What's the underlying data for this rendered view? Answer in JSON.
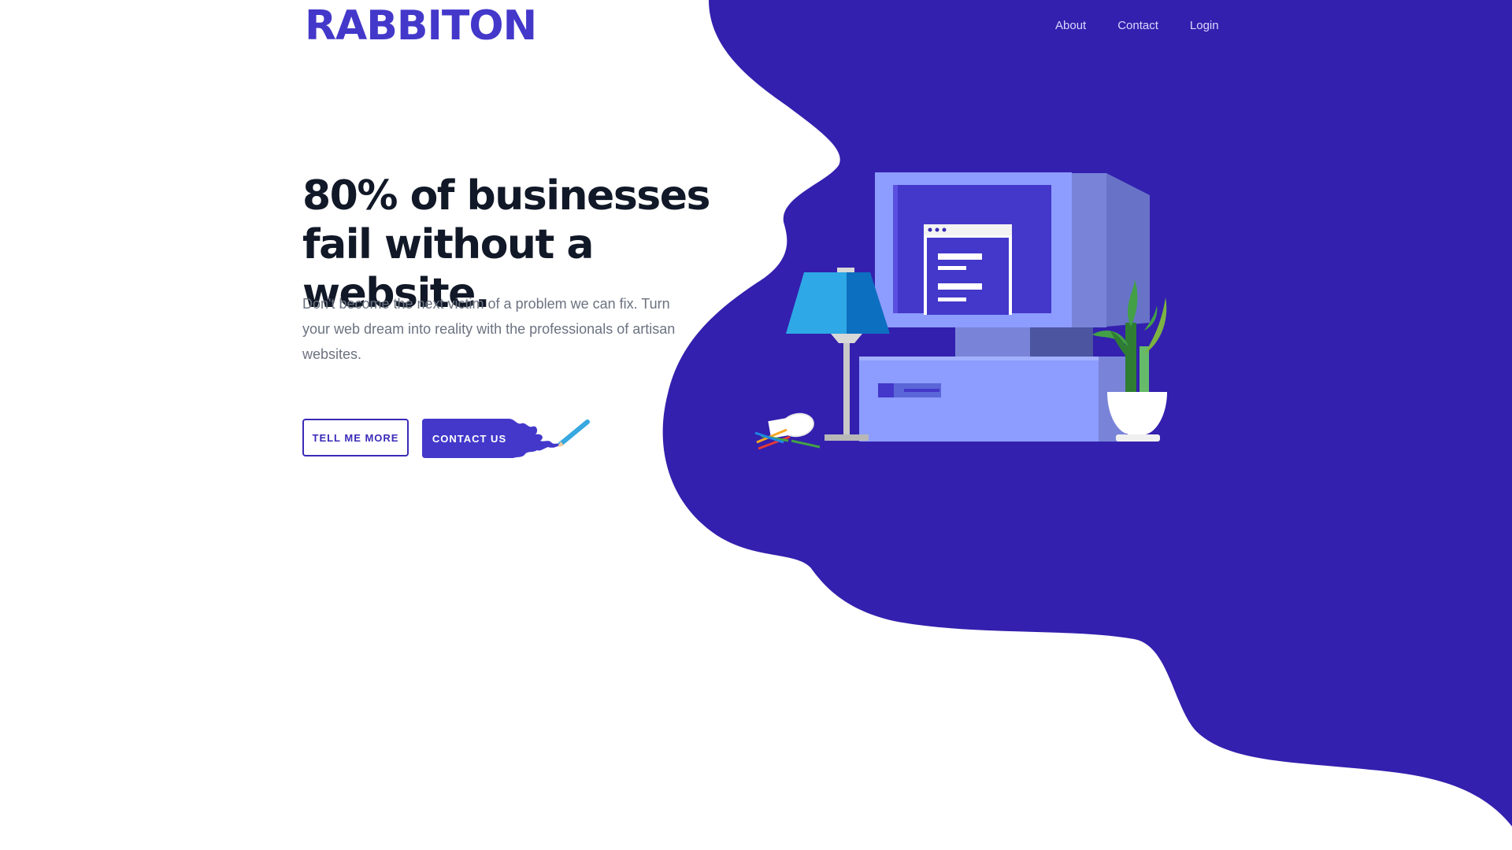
{
  "brand": {
    "logo_text": "RABBITON",
    "accent_color": "#4338ca",
    "background_blob_color": "#3320ae"
  },
  "nav": {
    "items": [
      {
        "label": "About"
      },
      {
        "label": "Contact"
      },
      {
        "label": "Login"
      }
    ]
  },
  "hero": {
    "headline_line1": "80% of businesses",
    "headline_line2": "fail without a website.",
    "subtext": "Don't become the next victim of a problem we can fix. Turn your web dream into reality with the professionals of artisan websites.",
    "primary_button_label": "TELL ME MORE",
    "secondary_button_label": "CONTACT US"
  },
  "illustration": {
    "icons": [
      "desktop-computer-icon",
      "desk-lamp-icon",
      "potted-plant-icon",
      "pencil-cup-icon",
      "pencil-icon"
    ]
  }
}
